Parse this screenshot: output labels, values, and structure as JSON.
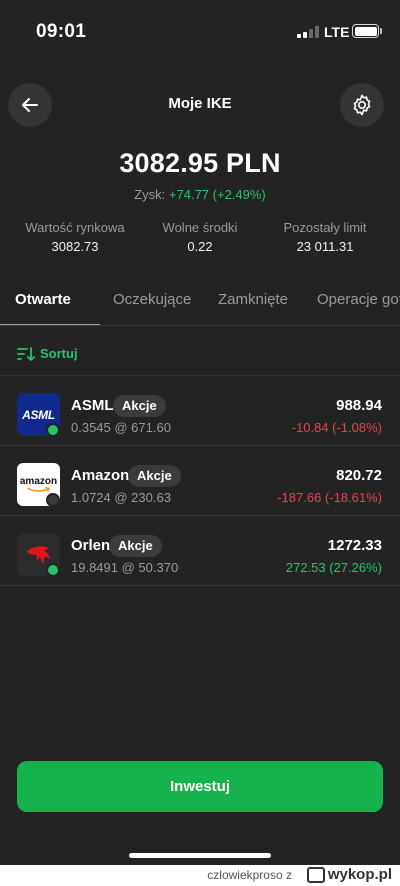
{
  "status": {
    "time": "09:01",
    "network": "LTE"
  },
  "header": {
    "title": "Moje IKE"
  },
  "summary": {
    "balance": "3082.95 PLN",
    "gain_label": "Zysk:",
    "gain_value": "+74.77 (+2.49%)",
    "stats": [
      {
        "label": "Wartość rynkowa",
        "value": "3082.73"
      },
      {
        "label": "Wolne środki",
        "value": "0.22"
      },
      {
        "label": "Pozostały limit",
        "value": "23 011.31"
      }
    ]
  },
  "tabs": [
    {
      "label": "Otwarte",
      "active": true
    },
    {
      "label": "Oczekujące",
      "active": false
    },
    {
      "label": "Zamknięte",
      "active": false
    },
    {
      "label": "Operacje got",
      "active": false
    }
  ],
  "sort": {
    "label": "Sortuj"
  },
  "positions": [
    {
      "name": "ASML",
      "type": "Akcje",
      "qty": "0.3545 @ 671.60",
      "value": "988.94",
      "change": "-10.84 (-1.08%)",
      "trend": "negative",
      "logo_text": "ASML",
      "status_dot": "#27c26a"
    },
    {
      "name": "Amazon",
      "type": "Akcje",
      "qty": "1.0724 @ 230.63",
      "value": "820.72",
      "change": "-187.66 (-18.61%)",
      "trend": "negative",
      "logo_text": "amazon",
      "status_dot": "#3a3a3a"
    },
    {
      "name": "Orlen",
      "type": "Akcje",
      "qty": "19.8491 @ 50.370",
      "value": "1272.33",
      "change": "272.53 (27.26%)",
      "trend": "positive",
      "status_dot": "#27c26a"
    }
  ],
  "cta": {
    "label": "Inwestuj"
  },
  "footer": {
    "user": "czlowiekproso",
    "prep": "z",
    "brand": "wykop.pl"
  },
  "colors": {
    "background": "#232323",
    "accent_green": "#16b24b",
    "gain_green": "#27c26a",
    "loss_red": "#e8414b"
  },
  "icons": [
    "back-arrow-icon",
    "gear-icon",
    "sort-icon",
    "signal-icon",
    "battery-icon"
  ]
}
